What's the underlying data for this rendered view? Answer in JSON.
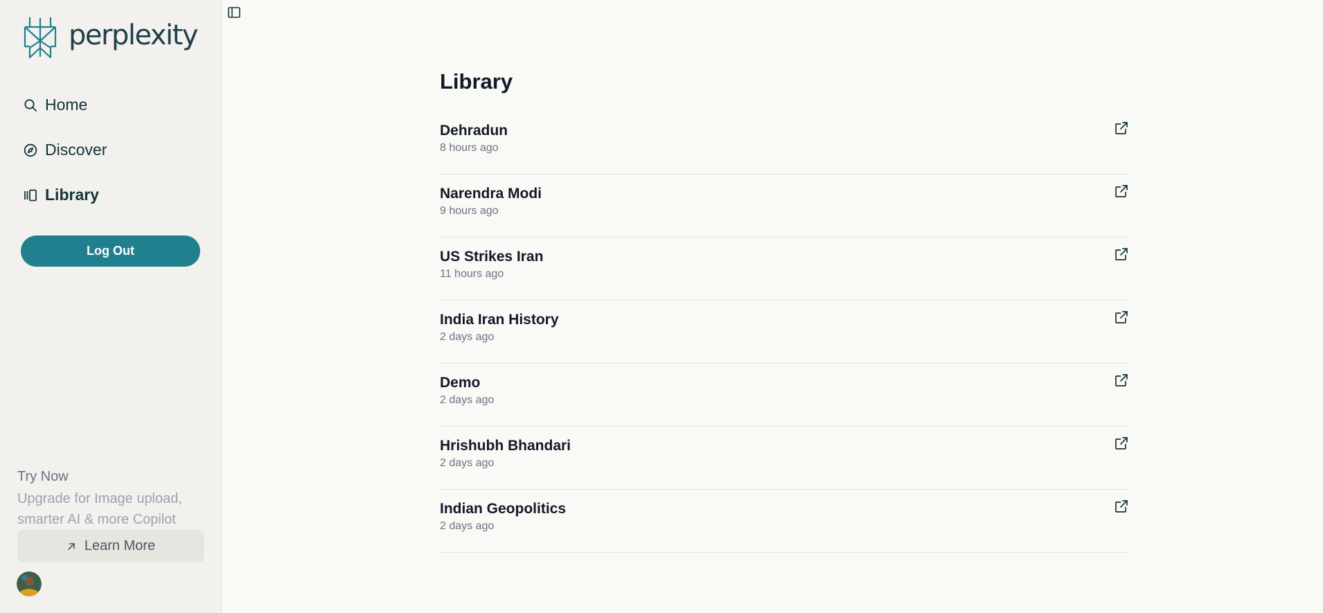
{
  "sidebar": {
    "logo_text": "perplexity",
    "nav": [
      {
        "label": "Home",
        "icon": "search-icon"
      },
      {
        "label": "Discover",
        "icon": "compass-icon"
      },
      {
        "label": "Library",
        "icon": "library-icon",
        "active": true
      }
    ],
    "logout_label": "Log Out",
    "promo": {
      "title": "Try Now",
      "text": "Upgrade for Image upload, smarter AI & more Copilot",
      "button_label": "Learn More"
    }
  },
  "main": {
    "title": "Library",
    "threads": [
      {
        "title": "Dehradun",
        "time": "8 hours ago"
      },
      {
        "title": "Narendra Modi",
        "time": "9 hours ago"
      },
      {
        "title": "US Strikes Iran",
        "time": "11 hours ago"
      },
      {
        "title": "India Iran History",
        "time": "2 days ago"
      },
      {
        "title": "Demo",
        "time": "2 days ago"
      },
      {
        "title": "Hrishubh Bhandari",
        "time": "2 days ago"
      },
      {
        "title": "Indian Geopolitics",
        "time": "2 days ago"
      }
    ]
  },
  "colors": {
    "accent": "#20808d",
    "sidebar_bg": "#f2f1ed",
    "main_bg": "#f9f9f6",
    "text_dark": "#111827",
    "text_muted": "#6b7280"
  }
}
